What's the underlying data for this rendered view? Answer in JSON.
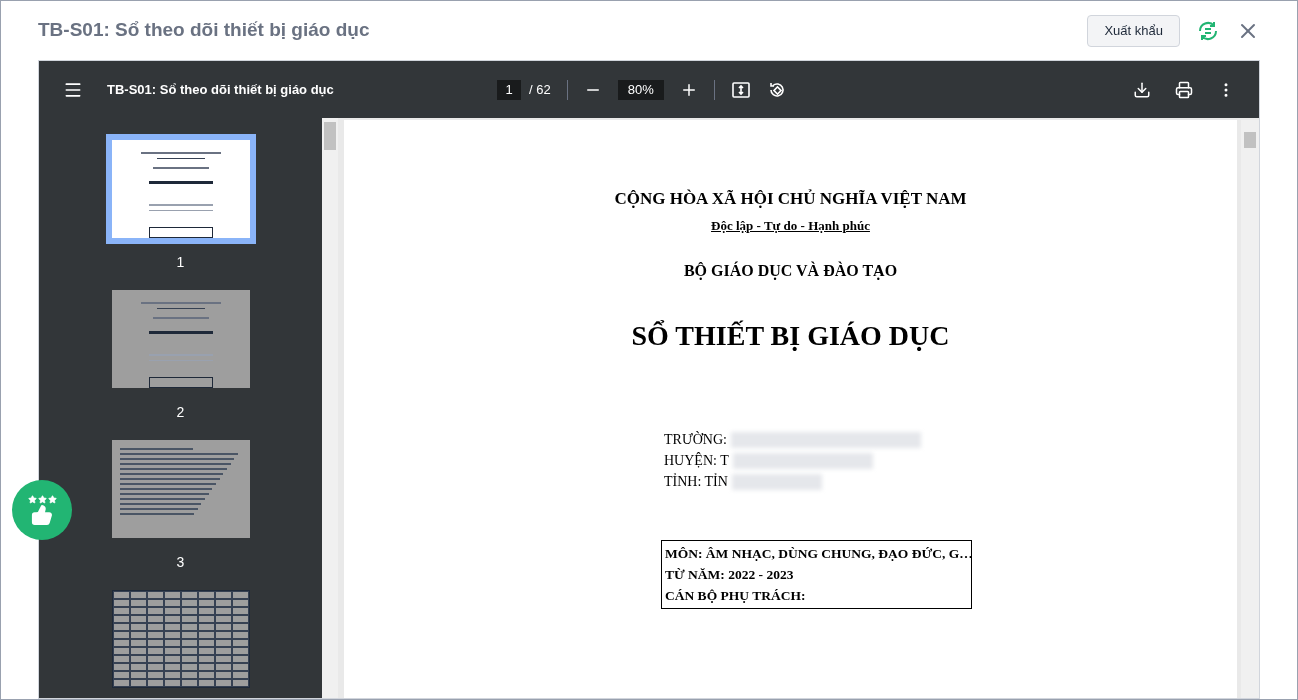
{
  "dialog": {
    "title": "TB-S01: Sổ theo dõi thiết bị giáo dục",
    "export_button": "Xuất khẩu"
  },
  "viewer": {
    "title": "TB-S01: Sổ theo dõi thiết bị giáo dục",
    "page_input": "1",
    "page_total": "/ 62",
    "zoom": "80%"
  },
  "thumbnails": [
    {
      "label": "1",
      "selected": true,
      "kind": "cover"
    },
    {
      "label": "2",
      "selected": false,
      "kind": "cover"
    },
    {
      "label": "3",
      "selected": false,
      "kind": "text"
    },
    {
      "selected": false,
      "kind": "table"
    }
  ],
  "document": {
    "heading": "CỘNG HÒA XÃ HỘI CHỦ NGHĨA VIỆT NAM",
    "motto": "Độc lập - Tự do - Hạnh phúc",
    "ministry": "BỘ GIÁO DỤC VÀ ĐÀO TẠO",
    "title": "SỔ THIẾT BỊ GIÁO DỤC",
    "fields": [
      "TRƯỜNG:",
      "HUYỆN: T",
      "TỈNH: TỈN"
    ],
    "box_lines": [
      "MÔN: ÂM NHẠC, DÙNG CHUNG, ĐẠO ĐỨC, G…",
      "TỪ NĂM: 2022 - 2023",
      "CÁN BỘ PHỤ TRÁCH:"
    ]
  }
}
